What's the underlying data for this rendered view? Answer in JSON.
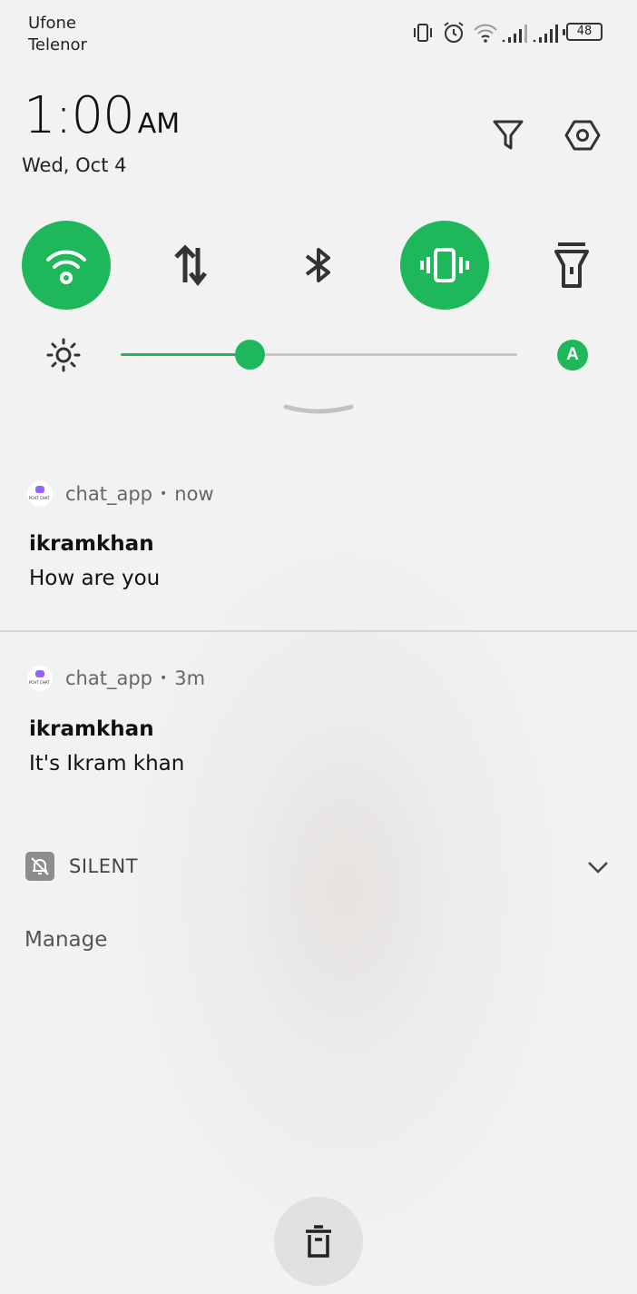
{
  "status_bar": {
    "carriers": [
      "Ufone",
      "Telenor"
    ],
    "icons": [
      "vibrate-icon",
      "alarm-icon",
      "wifi-icon",
      "signal-icon",
      "signal-icon"
    ],
    "battery_level": "48"
  },
  "header": {
    "time": "1:00",
    "ampm": "AM",
    "date": "Wed, Oct 4",
    "icons": [
      "filter-icon",
      "settings-icon"
    ]
  },
  "quick_tiles": [
    {
      "name": "wifi",
      "icon": "wifi-icon",
      "active": true
    },
    {
      "name": "mobile-data",
      "icon": "data-transfer-icon",
      "active": false
    },
    {
      "name": "bluetooth",
      "icon": "bluetooth-icon",
      "active": false
    },
    {
      "name": "vibrate",
      "icon": "vibrate-icon",
      "active": true
    },
    {
      "name": "flashlight",
      "icon": "flashlight-icon",
      "active": false
    }
  ],
  "brightness": {
    "level": 0.32,
    "auto_label": "A"
  },
  "notifications": [
    {
      "app": "chat_app",
      "time": "now",
      "title": "ikramkhan",
      "body": "How are you"
    },
    {
      "app": "chat_app",
      "time": "3m",
      "title": "ikramkhan",
      "body": "It's Ikram khan"
    }
  ],
  "silent_section": {
    "label": "SILENT"
  },
  "manage_label": "Manage",
  "accent_color": "#1eb85a"
}
